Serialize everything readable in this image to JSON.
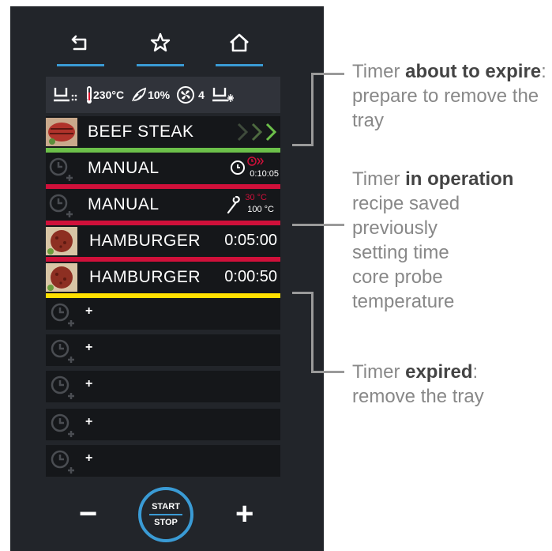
{
  "colors": {
    "panel": "#22252a",
    "accent": "#3a9bd5",
    "green": "#6cc04a",
    "red": "#d0103a",
    "yellow": "#ffe000"
  },
  "nav": {
    "back_icon": "back-icon",
    "favorite_icon": "star-icon",
    "home_icon": "home-icon"
  },
  "status": {
    "temperature": "230°C",
    "humidity": "10%",
    "fan_speed": "4"
  },
  "timers": [
    {
      "label": "BEEF STEAK",
      "value": "",
      "state": "about-to-expire",
      "bar_color": "#6cc04a",
      "thumb": "beef-steak"
    },
    {
      "label": "MANUAL",
      "value": "0:10:05",
      "state": "in-operation",
      "bar_color": "#d0103a",
      "thumb": "timer-slot"
    },
    {
      "label": "MANUAL",
      "value": "",
      "probe_set": "30 °C",
      "probe_read": "100 °C",
      "state": "in-operation",
      "bar_color": "#d0103a",
      "thumb": "timer-slot"
    },
    {
      "label": "HAMBURGER",
      "value": "0:05:00",
      "state": "in-operation",
      "bar_color": "#d0103a",
      "thumb": "hamburger"
    },
    {
      "label": "HAMBURGER",
      "value": "0:00:50",
      "state": "expired",
      "bar_color": "#ffe000",
      "thumb": "hamburger"
    }
  ],
  "empty_slots": [
    "+",
    "+",
    "+",
    "+",
    "+"
  ],
  "controls": {
    "minus": "−",
    "plus": "+",
    "start": "START",
    "stop": "STOP"
  },
  "callouts": {
    "about_to_expire": {
      "pre": "Timer ",
      "bold": "about to expire",
      "post": ": prepare to remove the tray"
    },
    "in_operation": {
      "pre": "Timer ",
      "bold": "in operation",
      "lines": [
        "recipe saved",
        "previously",
        "setting time",
        "core probe",
        "temperature"
      ]
    },
    "expired": {
      "pre": "Timer ",
      "bold": "expired",
      "post": ":",
      "line2": "remove the tray"
    }
  }
}
